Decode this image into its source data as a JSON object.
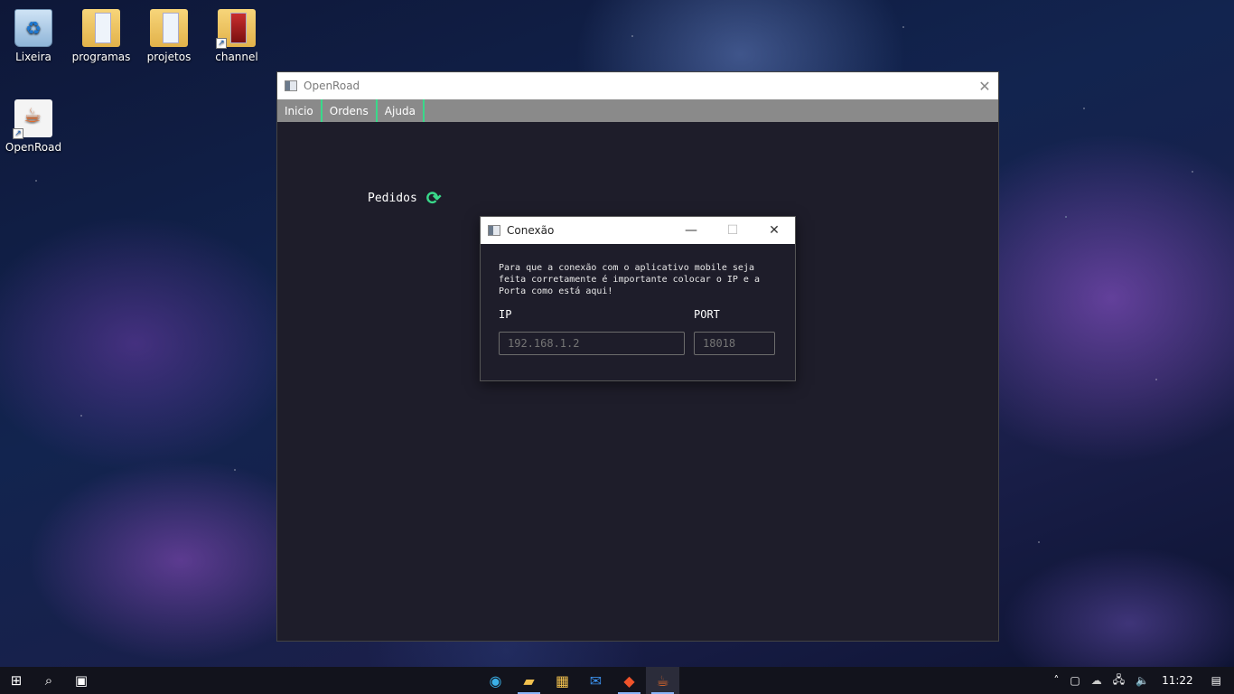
{
  "desktop": {
    "icons": [
      {
        "label": "Lixeira",
        "icon": "recycle-bin-icon"
      },
      {
        "label": "programas",
        "icon": "folder-icon"
      },
      {
        "label": "projetos",
        "icon": "folder-icon"
      },
      {
        "label": "channel",
        "icon": "folder-shortcut-icon"
      },
      {
        "label": "OpenRoad",
        "icon": "java-shortcut-icon"
      }
    ]
  },
  "main_window": {
    "title": "OpenRoad",
    "menu": [
      "Inicio",
      "Ordens",
      "Ajuda"
    ],
    "pedidos_label": "Pedidos",
    "accent": "#39d98a"
  },
  "dialog": {
    "title": "Conexão",
    "message": "Para que a conexão com o aplicativo mobile seja feita corretamente é importante colocar o IP e a Porta como está aqui!",
    "ip_label": "IP",
    "ip_placeholder": "192.168.1.2",
    "port_label": "PORT",
    "port_placeholder": "18018"
  },
  "taskbar": {
    "clock": "11:22"
  }
}
